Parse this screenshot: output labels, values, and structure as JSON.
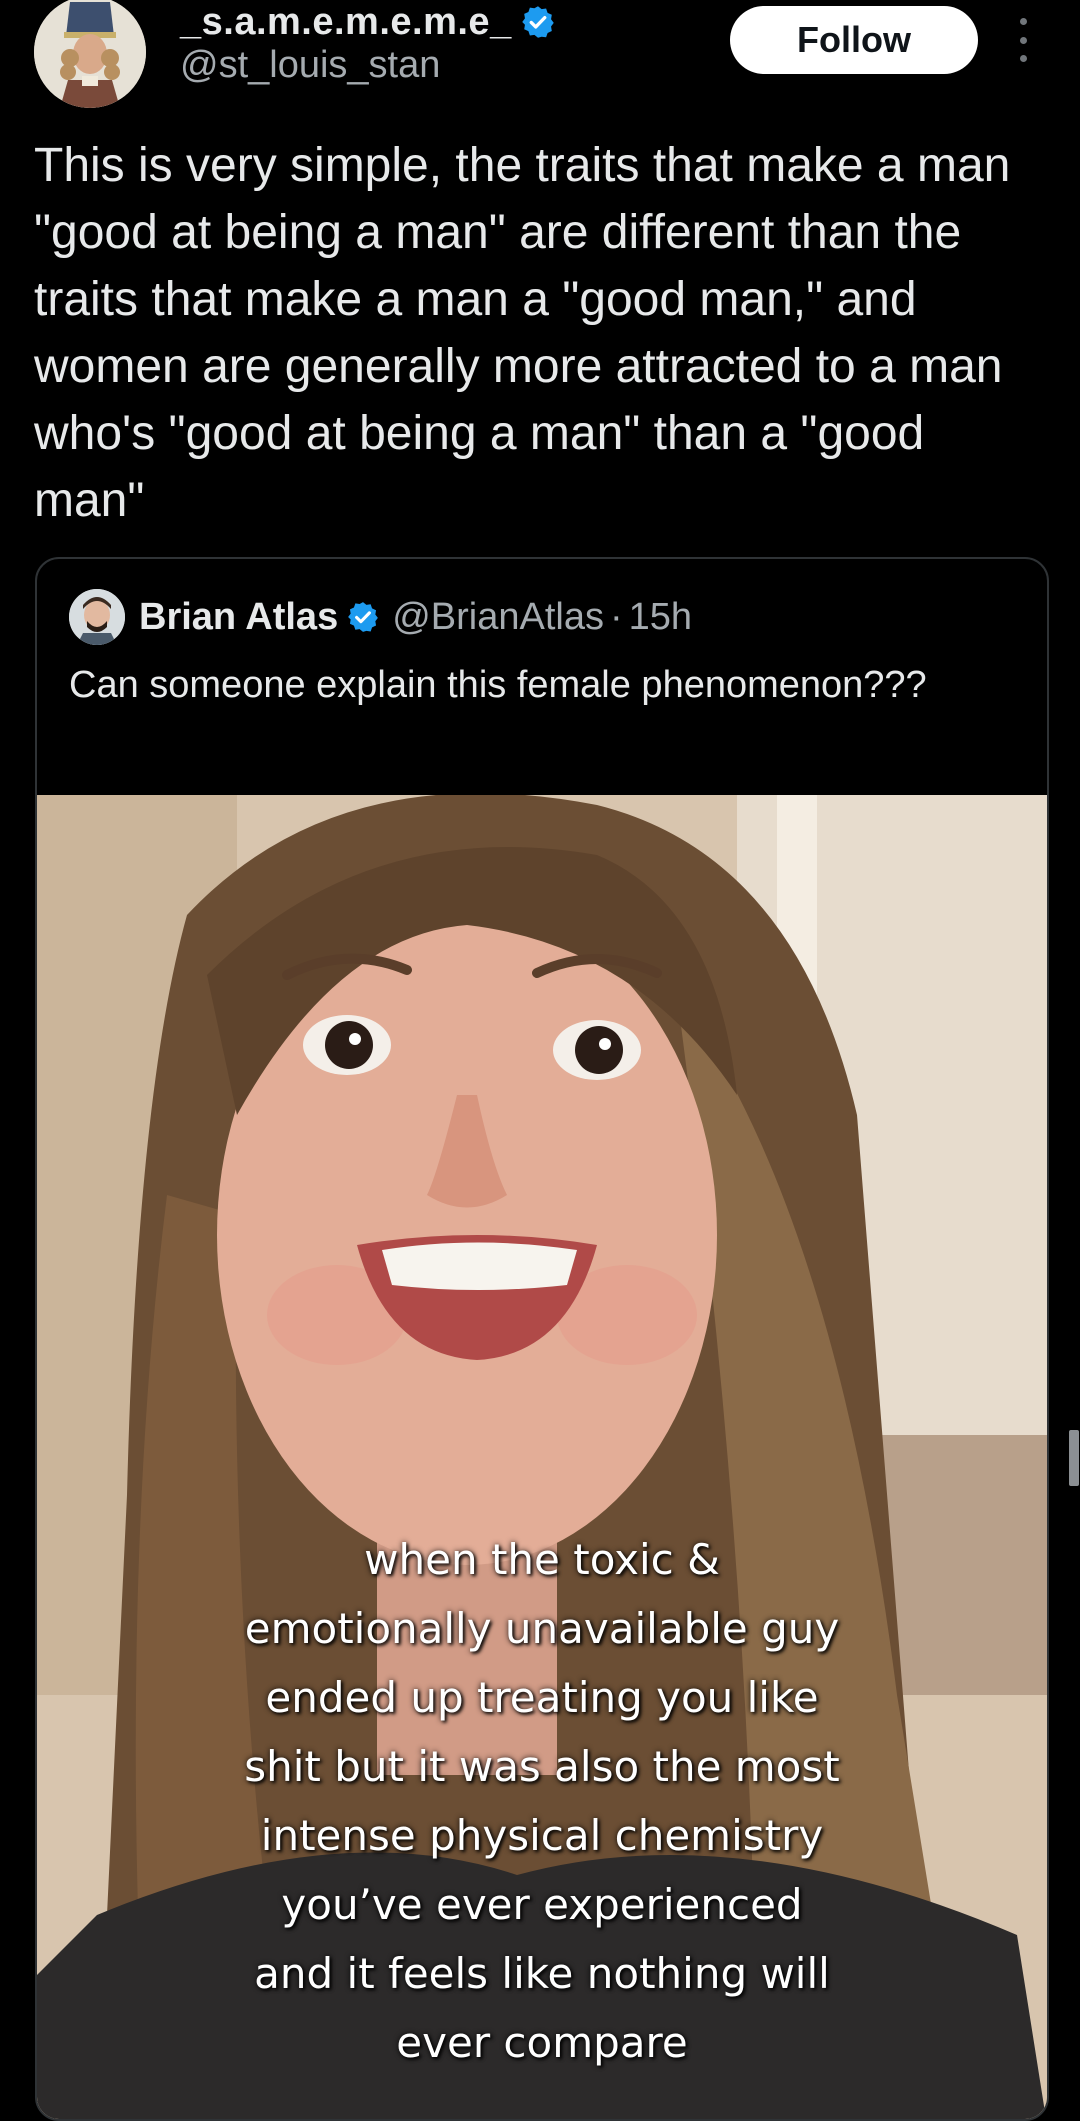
{
  "header": {
    "display_name": "_s.a.m.e.m.e.m.e_",
    "handle": "@st_louis_stan",
    "follow_label": "Follow",
    "verified": true
  },
  "tweet": {
    "text": "This is very simple, the traits that make a man \"good at being a man\" are different than the traits that make a man a \"good man,\" and women are generally more attracted to a man who's \"good at being a man\" than a \"good man\""
  },
  "quote": {
    "name": "Brian Atlas",
    "handle": "@BrianAtlas",
    "separator": "·",
    "time": "15h",
    "text": "Can someone explain this female phenomenon???",
    "verified": true,
    "media": {
      "caption": "when the toxic &\nemotionally unavailable guy\nended up treating you like\nshit but it was also the most\nintense physical chemistry\nyou’ve ever experienced\nand it feels like nothing will\never compare"
    }
  },
  "colors": {
    "background": "#000000",
    "text_primary": "#e7e9ea",
    "text_secondary": "#a5abb0",
    "verified_blue": "#1d9bf0",
    "follow_bg": "#ffffff",
    "border": "#2f3336"
  },
  "icons": {
    "verified": "verified-badge-icon",
    "more": "more-vertical-icon"
  }
}
